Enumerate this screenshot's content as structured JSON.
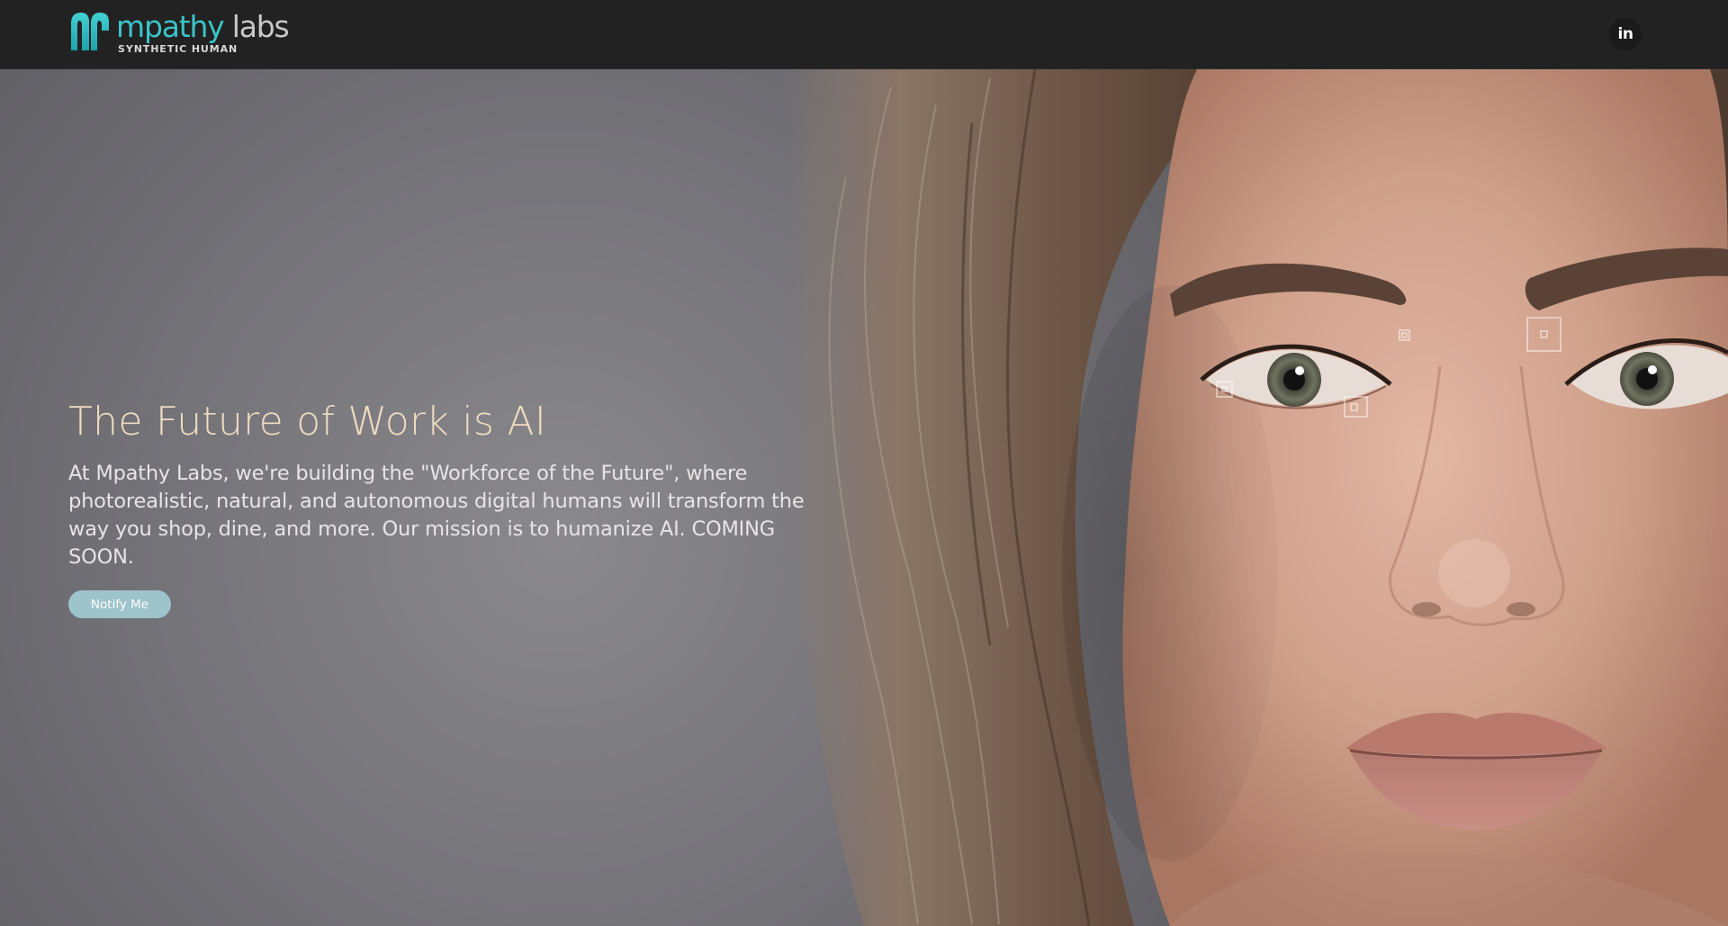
{
  "brand": {
    "name_part1": "mpathy",
    "name_part2": " labs",
    "tagline": "SYNTHETIC HUMAN",
    "accent_color": "#3bc4c8"
  },
  "header": {
    "social": {
      "icon": "linkedin-icon",
      "label": "in"
    }
  },
  "hero": {
    "title": "The Future of Work is AI",
    "description": "At Mpathy Labs, we're building the \"Workforce of the Future\", where photorealistic, natural, and autonomous digital humans will transform the way you shop, dine, and more. Our mission is to humanize AI. COMING SOON.",
    "cta_label": "Notify Me",
    "title_color": "#f0dcc0",
    "cta_color": "#9dc3cb"
  }
}
